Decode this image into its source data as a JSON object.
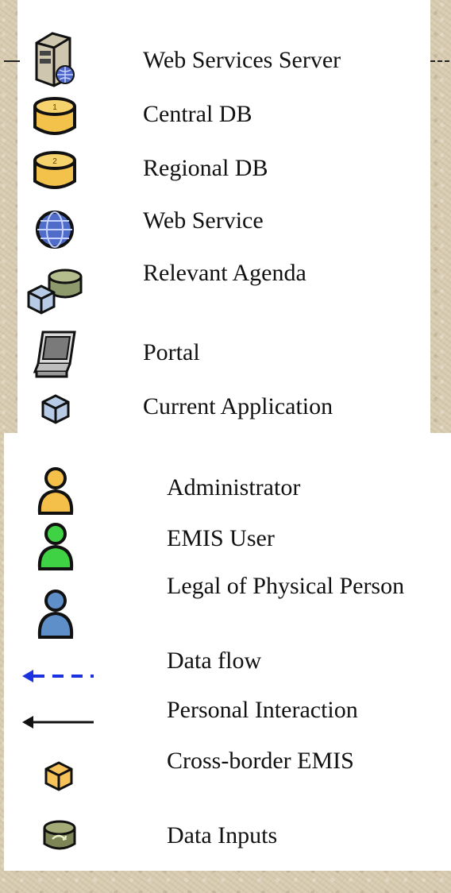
{
  "legend_top": [
    {
      "icon": "server-icon",
      "label": "Web Services Server"
    },
    {
      "icon": "database-1-icon",
      "label": "Central DB"
    },
    {
      "icon": "database-2-icon",
      "label": "Regional DB"
    },
    {
      "icon": "globe-icon",
      "label": "Web Service"
    },
    {
      "icon": "cube-database-icon",
      "label": "Relevant Agenda"
    },
    {
      "icon": "monitor-icon",
      "label": "Portal"
    },
    {
      "icon": "cube-blue-icon",
      "label": "Current Application"
    }
  ],
  "legend_bottom": [
    {
      "icon": "user-orange-icon",
      "label": "Administrator"
    },
    {
      "icon": "user-green-icon",
      "label": "EMIS User"
    },
    {
      "icon": "user-blue-icon",
      "label": "Legal of Physical Person"
    },
    {
      "icon": "dashed-arrow-icon",
      "label": "Data flow"
    },
    {
      "icon": "solid-arrow-icon",
      "label": "Personal Interaction"
    },
    {
      "icon": "cube-orange-icon",
      "label": "Cross-border EMIS"
    },
    {
      "icon": "data-input-icon",
      "label": "Data Inputs"
    }
  ],
  "colors": {
    "db_yellow": "#f2c24a",
    "user_orange": "#f4c04a",
    "user_green": "#3fd244",
    "user_blue": "#5f8fc8",
    "flow_blue": "#1b32e0",
    "cube_blue": "#b7cbe6",
    "cube_orange": "#f6c35a"
  }
}
